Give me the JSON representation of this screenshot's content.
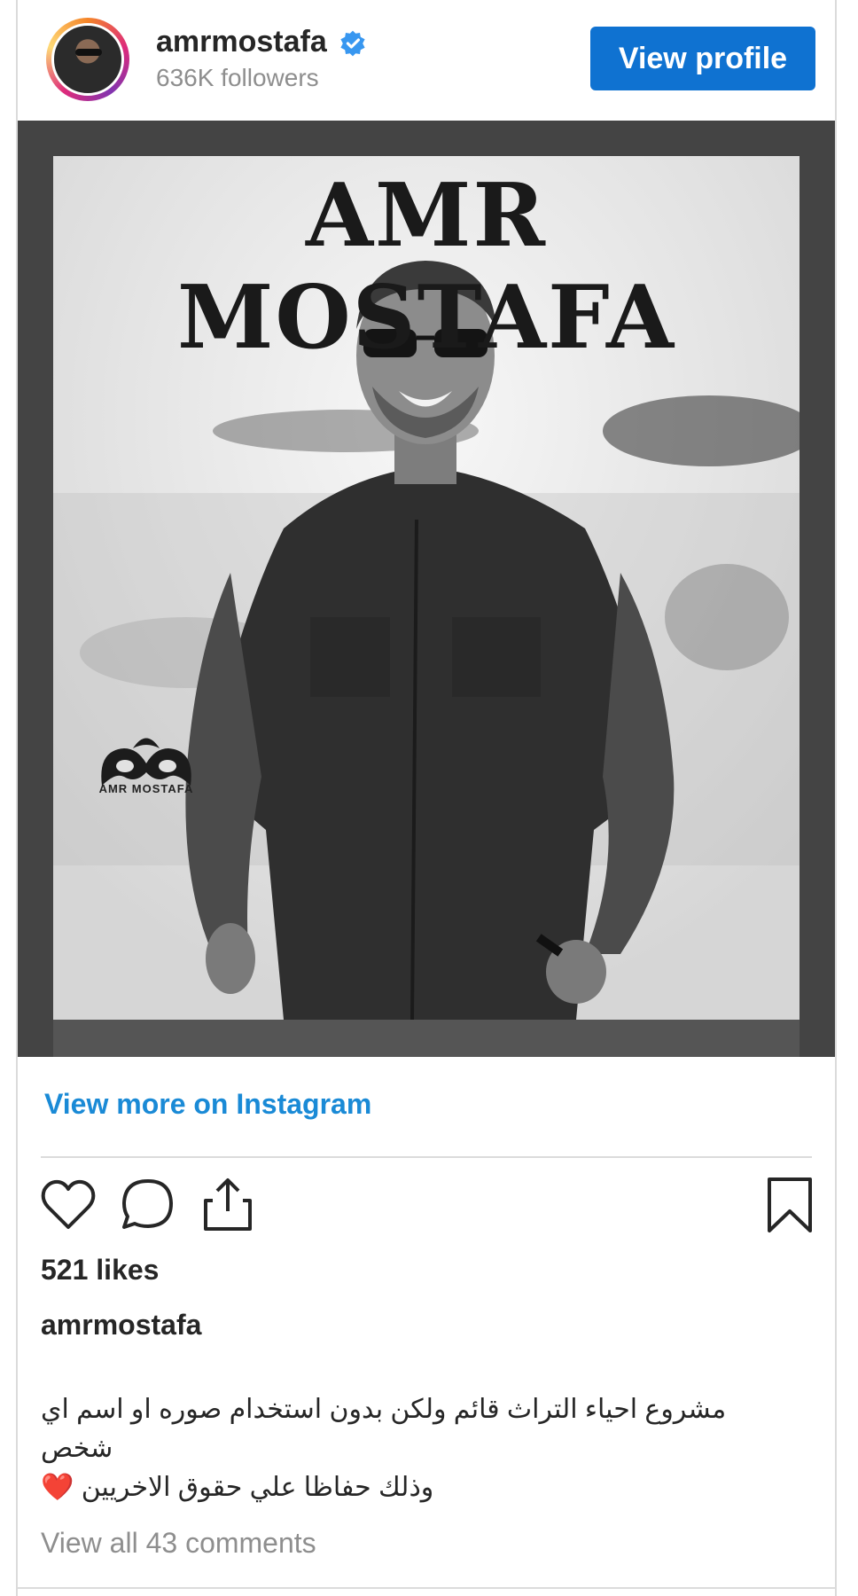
{
  "header": {
    "username": "amrmostafa",
    "followers": "636K followers",
    "view_profile_label": "View profile",
    "verified_icon": "verified-badge-icon",
    "accent_color": "#0f72d1"
  },
  "post": {
    "poster_title": "AMR MOSTAFA",
    "logo_text": "AMR MOSTAFA",
    "view_more_label": "View more on Instagram",
    "likes": "521 likes",
    "caption_user": "amrmostafa",
    "caption_line1": "مشروع احياء التراث قائم ولكن بدون استخدام صوره او اسم اي شخص",
    "caption_line2": "وذلك حفاظا علي حقوق الاخريين ❤️",
    "comments_label": "View all 43 comments",
    "link_color": "#1a8ad6"
  },
  "actions": {
    "like": "heart-icon",
    "comment": "comment-bubble-icon",
    "share": "share-upload-icon",
    "save": "bookmark-icon"
  }
}
